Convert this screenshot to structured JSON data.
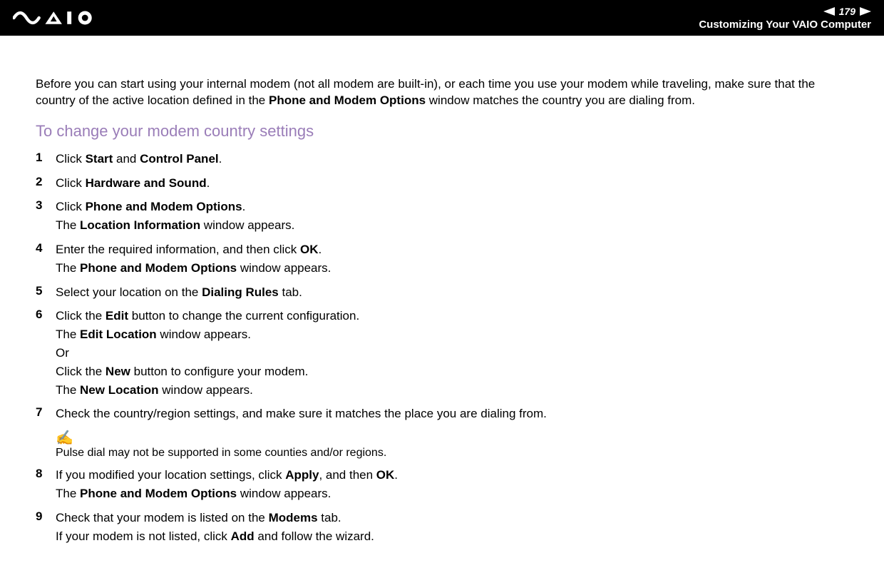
{
  "header": {
    "page_number": "179",
    "subtitle": "Customizing Your VAIO Computer"
  },
  "intro": {
    "part1": "Before you can start using your internal modem (not all modem are built-in), or each time you use your modem while traveling, make sure that the country of the active location defined in the ",
    "bold1": "Phone and Modem Options",
    "part2": " window matches the country you are dialing from."
  },
  "section_heading": "To change your modem country settings",
  "steps": {
    "s1": {
      "num": "1",
      "t1": "Click ",
      "b1": "Start",
      "t2": " and ",
      "b2": "Control Panel",
      "t3": "."
    },
    "s2": {
      "num": "2",
      "t1": "Click ",
      "b1": "Hardware and Sound",
      "t2": "."
    },
    "s3": {
      "num": "3",
      "t1": "Click ",
      "b1": "Phone and Modem Options",
      "t2": ".",
      "l2a": "The ",
      "l2b": "Location Information",
      "l2c": " window appears."
    },
    "s4": {
      "num": "4",
      "t1": "Enter the required information, and then click ",
      "b1": "OK",
      "t2": ".",
      "l2a": "The ",
      "l2b": "Phone and Modem Options",
      "l2c": " window appears."
    },
    "s5": {
      "num": "5",
      "t1": "Select your location on the ",
      "b1": "Dialing Rules",
      "t2": " tab."
    },
    "s6": {
      "num": "6",
      "t1": "Click the ",
      "b1": "Edit",
      "t2": " button to change the current configuration.",
      "l2a": "The ",
      "l2b": "Edit Location",
      "l2c": " window appears.",
      "l3": "Or",
      "l4a": "Click the ",
      "l4b": "New",
      "l4c": " button to configure your modem.",
      "l5a": "The ",
      "l5b": "New Location",
      "l5c": " window appears."
    },
    "s7": {
      "num": "7",
      "t1": "Check the country/region settings, and make sure it matches the place you are dialing from."
    },
    "note": {
      "icon": "✍",
      "text": "Pulse dial may not be supported in some counties and/or regions."
    },
    "s8": {
      "num": "8",
      "t1": "If you modified your location settings, click ",
      "b1": "Apply",
      "t2": ", and then ",
      "b2": "OK",
      "t3": ".",
      "l2a": "The ",
      "l2b": "Phone and Modem Options",
      "l2c": " window appears."
    },
    "s9": {
      "num": "9",
      "t1": "Check that your modem is listed on the ",
      "b1": "Modems",
      "t2": " tab.",
      "l2a": "If your modem is not listed, click ",
      "l2b": "Add",
      "l2c": " and follow the wizard."
    }
  }
}
